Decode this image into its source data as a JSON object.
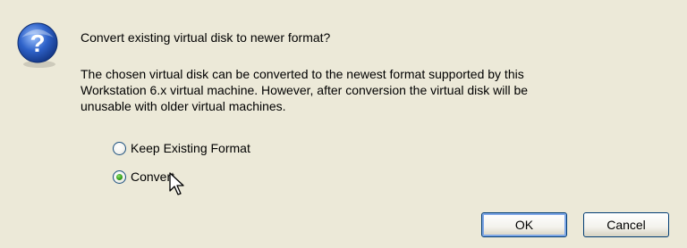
{
  "dialog": {
    "question": "Convert existing virtual disk to newer format?",
    "body_lines": [
      "The chosen virtual disk can be converted to the newest format supported by this",
      "Workstation 6.x virtual machine.  However, after conversion the virtual disk will be",
      "unusable with older virtual machines."
    ],
    "options": [
      {
        "label": "Keep Existing Format",
        "checked": false
      },
      {
        "label": "Convert",
        "checked": true
      }
    ],
    "buttons": {
      "ok_label": "OK",
      "cancel_label": "Cancel"
    },
    "icon": "question-icon"
  }
}
